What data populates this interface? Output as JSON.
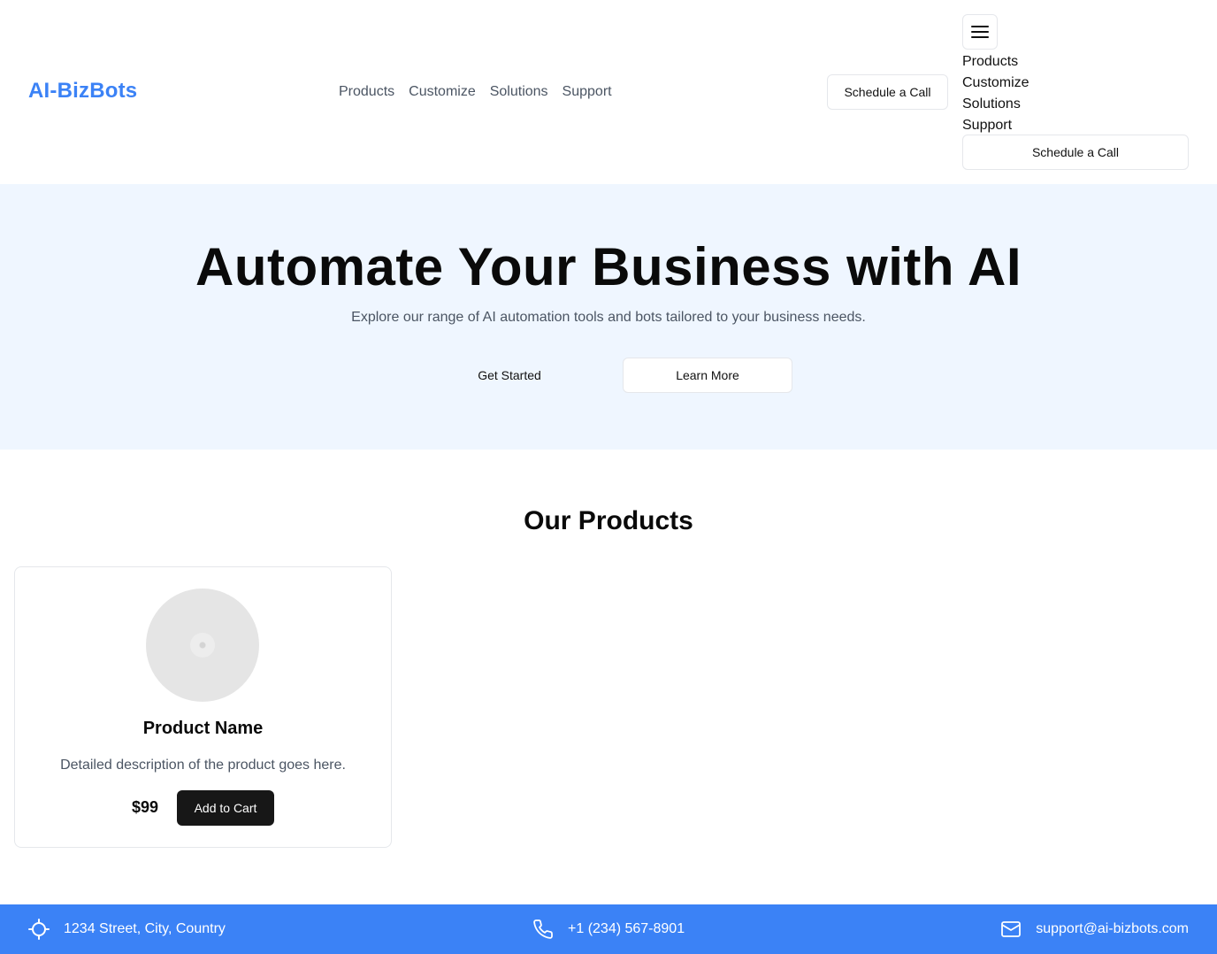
{
  "brand": {
    "name": "AI-BizBots",
    "color": "#3b82f6"
  },
  "nav": {
    "items": [
      "Products",
      "Customize",
      "Solutions",
      "Support"
    ]
  },
  "header": {
    "schedule_label": "Schedule a Call",
    "menu_icon": "hamburger-menu-icon"
  },
  "mobile_menu": {
    "items": [
      "Products",
      "Customize",
      "Solutions",
      "Support"
    ],
    "schedule_label": "Schedule a Call"
  },
  "hero": {
    "title": "Automate Your Business with AI",
    "subtitle": "Explore our range of AI automation tools and bots tailored to your business needs.",
    "primary_label": "Get Started",
    "secondary_label": "Learn More",
    "background": "#eff6ff"
  },
  "products": {
    "title": "Our Products",
    "items": [
      {
        "name": "Product Name",
        "description": "Detailed description of the product goes here.",
        "price": "$99",
        "cart_label": "Add to Cart"
      }
    ]
  },
  "footer": {
    "address": "1234 Street, City, Country",
    "phone": "+1 (234) 567-8901",
    "email": "support@ai-bizbots.com",
    "background": "#3b82f6"
  }
}
